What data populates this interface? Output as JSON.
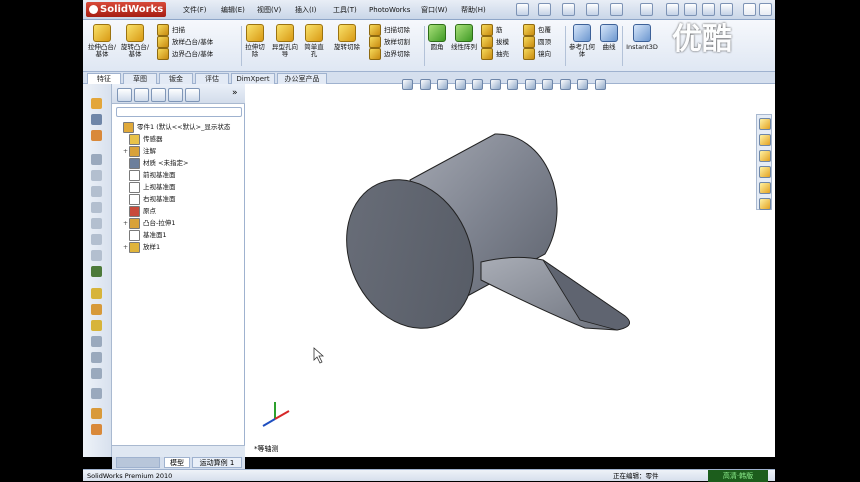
{
  "app": {
    "brand": "SolidWorks"
  },
  "menu": [
    "文件(F)",
    "编辑(E)",
    "视图(V)",
    "插入(I)",
    "工具(T)",
    "PhotoWorks",
    "窗口(W)",
    "帮助(H)"
  ],
  "ribbon": {
    "big_buttons": [
      "拉伸凸台/基体",
      "旋转凸台/基体",
      "拉伸切除",
      "异型孔向导",
      "简单直孔",
      "旋转切除",
      "圆角",
      "线性阵列",
      "参考几何体",
      "曲线",
      "Instant3D"
    ],
    "rows_a": [
      "扫描",
      "放样凸台/基体",
      "边界凸台/基体"
    ],
    "rows_b": [
      "扫描切除",
      "放样切割",
      "边界切除"
    ],
    "rows_c": [
      "筋",
      "拔模",
      "抽壳"
    ],
    "rows_d": [
      "包覆",
      "圆顶",
      "镜向"
    ]
  },
  "tabs": [
    "特征",
    "草图",
    "钣金",
    "评估",
    "DimXpert",
    "办公室产品"
  ],
  "feature_tree": [
    {
      "label": "零件1  (默认<<默认>_显示状态",
      "expand": "",
      "icon": "part"
    },
    {
      "label": "传感器",
      "expand": "",
      "icon": "folder"
    },
    {
      "label": "注解",
      "expand": "+",
      "icon": "annotation"
    },
    {
      "label": "材质 <未指定>",
      "expand": "",
      "icon": "material"
    },
    {
      "label": "前视基准面",
      "expand": "",
      "icon": "plane"
    },
    {
      "label": "上视基准面",
      "expand": "",
      "icon": "plane"
    },
    {
      "label": "右视基准面",
      "expand": "",
      "icon": "plane"
    },
    {
      "label": "原点",
      "expand": "",
      "icon": "origin"
    },
    {
      "label": "凸台-拉伸1",
      "expand": "+",
      "icon": "extrude"
    },
    {
      "label": "基准面1",
      "expand": "",
      "icon": "plane"
    },
    {
      "label": "放样1",
      "expand": "+",
      "icon": "loft"
    }
  ],
  "bottom_tabs": [
    "模型",
    "运动算例 1"
  ],
  "view_label": "*等轴测",
  "status": {
    "left": "SolidWorks Premium 2010",
    "right": "正在编辑：零件"
  },
  "watermark": "优酷",
  "watermark_badge": "高清·韩版",
  "colors": {
    "accent": "#c0291c",
    "panel": "#d5dfee",
    "model_gray": "#8a8f99"
  }
}
